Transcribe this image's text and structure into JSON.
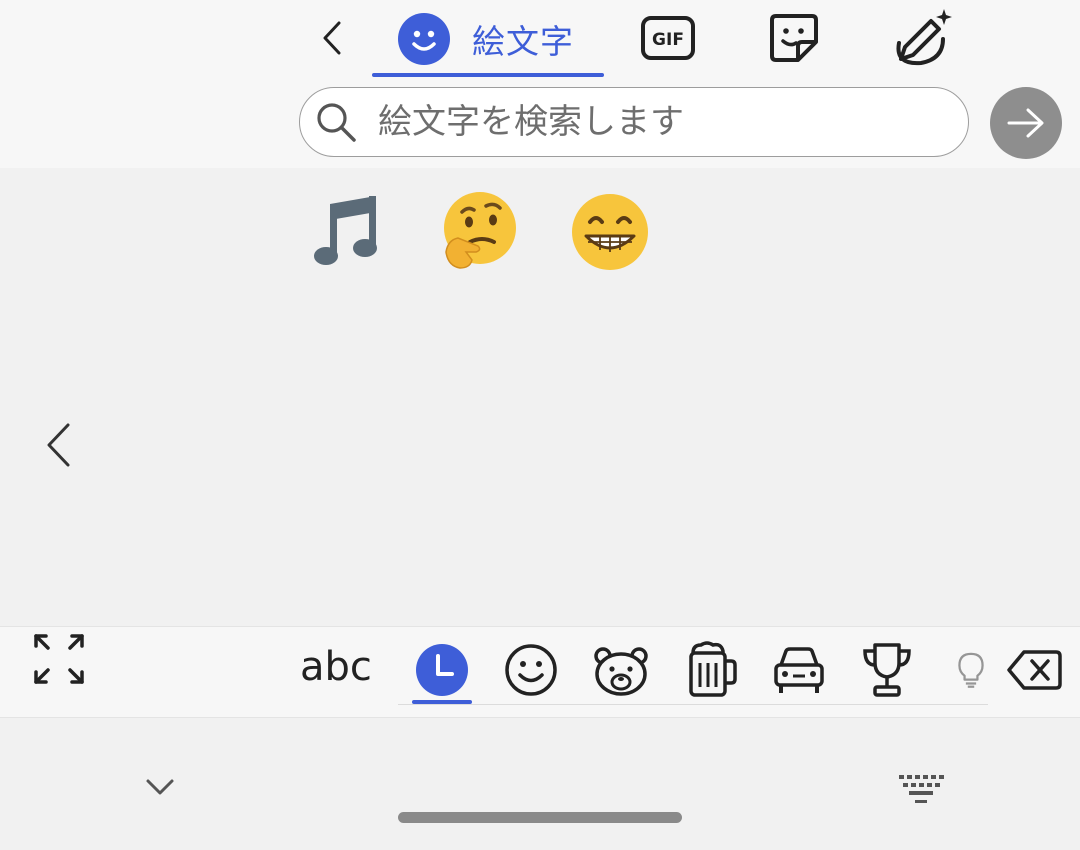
{
  "top_tabs": {
    "emoji_tab_label": "絵文字",
    "gif_label": "GIF"
  },
  "search": {
    "placeholder": "絵文字を検索します",
    "value": ""
  },
  "recent_emojis": [
    "🎵",
    "🤔",
    "😁"
  ],
  "category_bar": {
    "abc_label": "abc",
    "categories": [
      "recent-clock",
      "smileys",
      "animals",
      "food-drink",
      "travel-car",
      "activities-trophy",
      "objects-bulb"
    ],
    "selected": "recent-clock"
  },
  "colors": {
    "accent": "#3e5ed8",
    "background": "#f1f1f1",
    "bar": "#f7f7f7",
    "send_button": "#8e8e8e"
  }
}
